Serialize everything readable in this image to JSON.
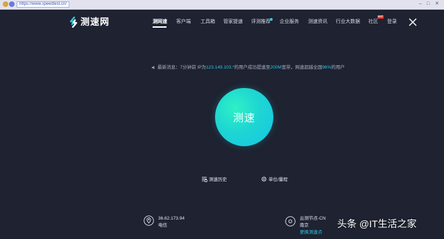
{
  "browser": {
    "url": "https://www.speedtest.cn/",
    "min": "–",
    "max": "□",
    "close": "✕"
  },
  "site": {
    "logo_text": "测速网",
    "nav": [
      {
        "label": "测网速"
      },
      {
        "label": "客户端"
      },
      {
        "label": "工具箱"
      },
      {
        "label": "管家提速"
      },
      {
        "label": "评测推荐"
      },
      {
        "label": "企业服务"
      },
      {
        "label": "测速资讯"
      },
      {
        "label": "行业大数据"
      },
      {
        "label": "社区"
      },
      {
        "label": "登录"
      }
    ],
    "hot_badge": "HOT"
  },
  "news": {
    "prefix": "最新消息：7分钟前 IP为",
    "ip": "123.149.103.*",
    "middle": "的用户成功提速至",
    "bandwidth": "200M",
    "suffix1": "宽带，网速超越全国",
    "percent": "96%",
    "suffix2": "的用户"
  },
  "start_label": "测速",
  "tools": {
    "history": "测速历史",
    "units": "单位/量程"
  },
  "info": {
    "ip": "36.62.173.94",
    "isp": "电信",
    "node": "云测节点-CN",
    "city": "南京",
    "change_node": "更换测速点"
  },
  "watermark": "头条 @IT生活之家",
  "colors": {
    "background": "#1e2231",
    "accent": "#2ac5de",
    "start_gradient_from": "#2ff0c6",
    "start_gradient_to": "#17c6e6"
  }
}
